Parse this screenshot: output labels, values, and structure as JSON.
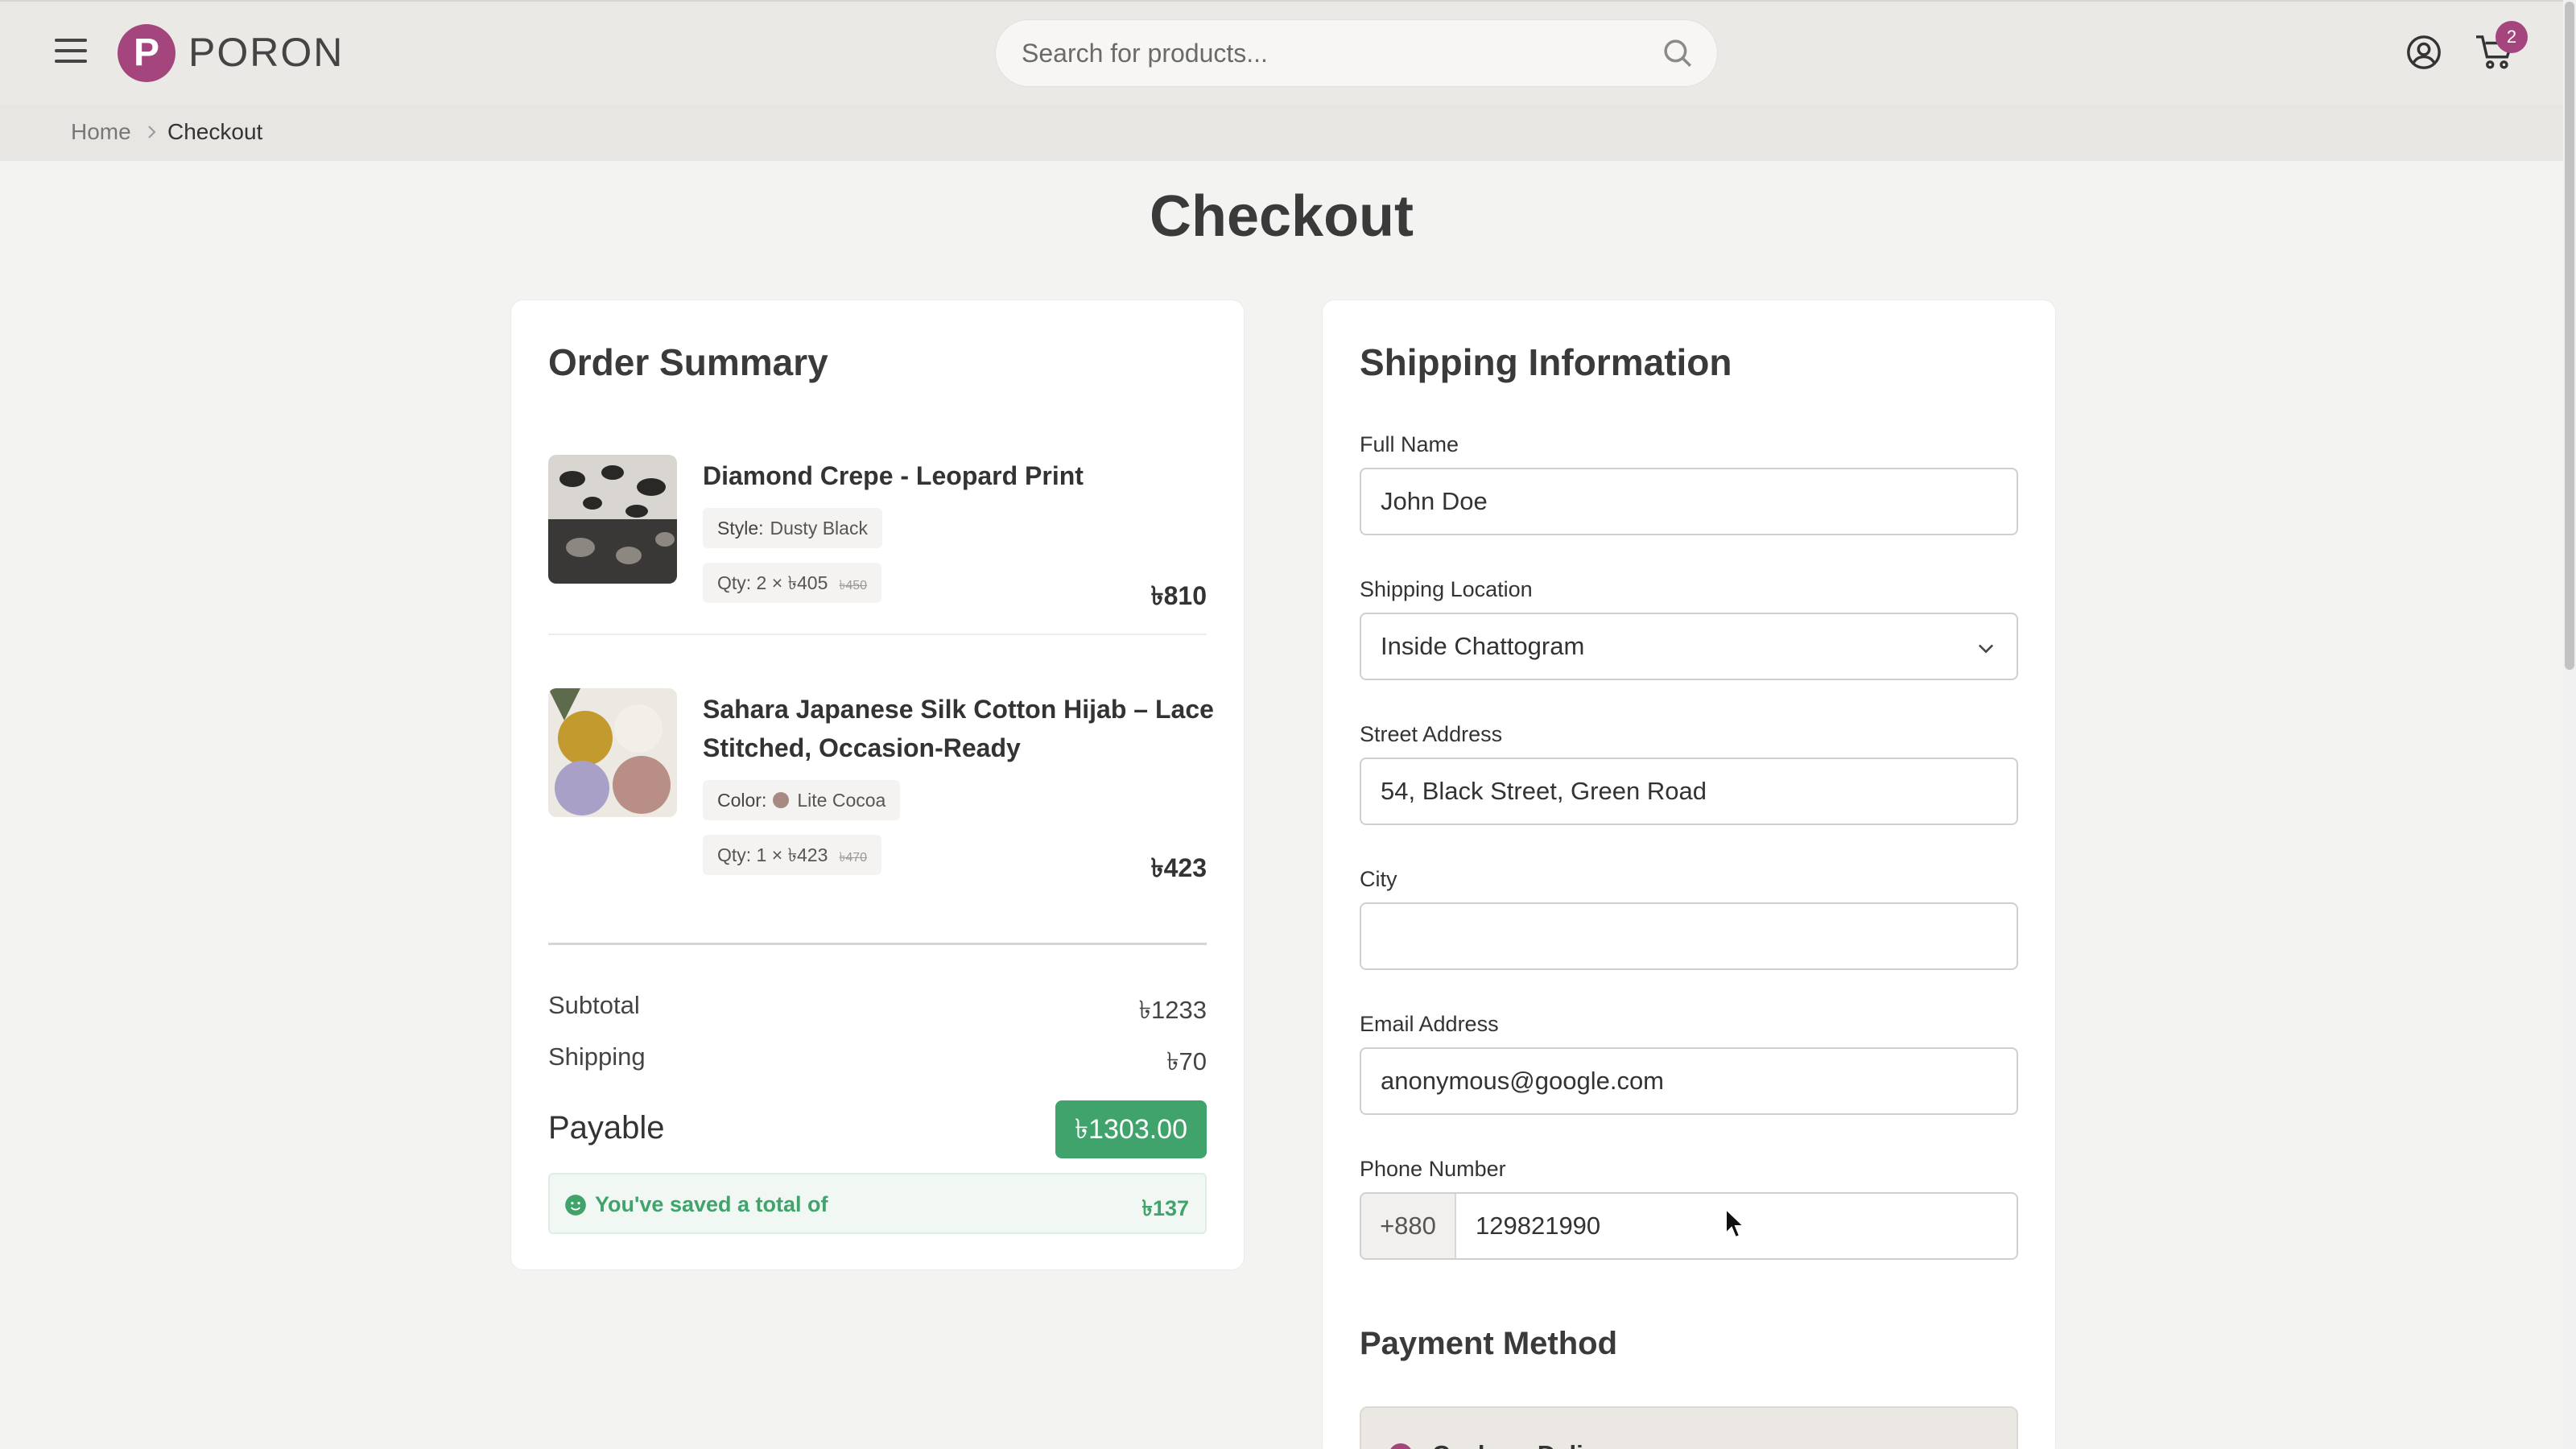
{
  "header": {
    "logo_mark": "P",
    "logo_text": "PORON",
    "search_placeholder": "Search for products...",
    "cart_count": "2"
  },
  "breadcrumb": {
    "home": "Home",
    "current": "Checkout"
  },
  "page_title": "Checkout",
  "order_summary": {
    "title": "Order Summary",
    "items": [
      {
        "name": "Diamond Crepe - Leopard Print",
        "variant_key": "Style:",
        "variant_value": "Dusty Black",
        "qty_text": "Qty: 2 × ৳405",
        "original_price": "৳450",
        "line_total": "৳810"
      },
      {
        "name": "Sahara Japanese Silk Cotton Hijab – Lace Stitched, Occasion-Ready",
        "variant_key": "Color:",
        "variant_value": "Lite Cocoa",
        "qty_text": "Qty: 1 × ৳423",
        "original_price": "৳470",
        "line_total": "৳423"
      }
    ],
    "subtotal_label": "Subtotal",
    "subtotal_value": "৳1233",
    "shipping_label": "Shipping",
    "shipping_value": "৳70",
    "payable_label": "Payable",
    "payable_value": "৳1303.00",
    "saved_label": "You've saved a total of",
    "saved_value": "৳137"
  },
  "shipping_info": {
    "title": "Shipping Information",
    "full_name_label": "Full Name",
    "full_name_value": "John Doe",
    "location_label": "Shipping Location",
    "location_value": "Inside Chattogram",
    "street_label": "Street Address",
    "street_value": "54, Black Street, Green Road",
    "city_label": "City",
    "city_value": "",
    "email_label": "Email Address",
    "email_value": "anonymous@google.com",
    "phone_label": "Phone Number",
    "phone_prefix": "+880",
    "phone_value": "129821990",
    "payment_title": "Payment Method",
    "payment_option": "Cash on Delivery"
  },
  "colors": {
    "brand": "#a5457d",
    "success": "#3fa36b",
    "header_bg": "#ebe9e6"
  }
}
